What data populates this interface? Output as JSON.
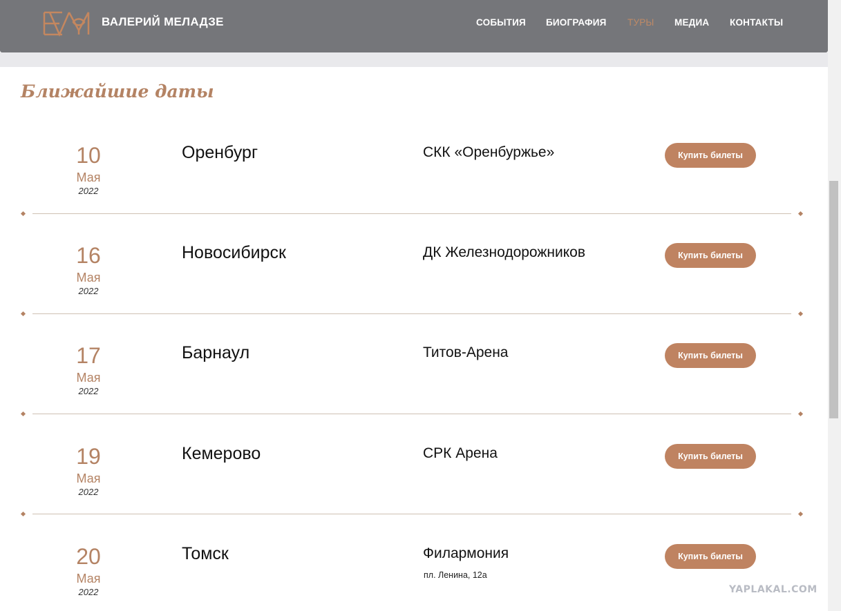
{
  "header": {
    "site_name": "ВАЛЕРИЙ МЕЛАДЗЕ",
    "logo_icon": "vm-monogram-logo",
    "nav": [
      {
        "label": "СОБЫТИЯ",
        "active": false
      },
      {
        "label": "БИОГРАФИЯ",
        "active": false
      },
      {
        "label": "ТУРЫ",
        "active": true
      },
      {
        "label": "МЕДИА",
        "active": false
      },
      {
        "label": "КОНТАКТЫ",
        "active": false
      }
    ]
  },
  "main": {
    "section_title": "Ближайшие даты",
    "events": [
      {
        "day": "10",
        "month": "Мая",
        "year": "2022",
        "city": "Оренбург",
        "venue": "СКК «Оренбуржье»",
        "address": "",
        "button": "Купить билеты"
      },
      {
        "day": "16",
        "month": "Мая",
        "year": "2022",
        "city": "Новосибирск",
        "venue": "ДК Железнодорожников",
        "address": "",
        "button": "Купить билеты"
      },
      {
        "day": "17",
        "month": "Мая",
        "year": "2022",
        "city": "Барнаул",
        "venue": "Титов-Арена",
        "address": "",
        "button": "Купить билеты"
      },
      {
        "day": "19",
        "month": "Мая",
        "year": "2022",
        "city": "Кемерово",
        "venue": "СРК Арена",
        "address": "",
        "button": "Купить билеты"
      },
      {
        "day": "20",
        "month": "Мая",
        "year": "2022",
        "city": "Томск",
        "venue": "Филармония",
        "address": "пл. Ленина, 12а",
        "button": "Купить билеты"
      }
    ]
  },
  "watermark": "YAPLAKAL.COM",
  "colors": {
    "accent": "#bf8361",
    "header_bg": "#75767a",
    "nav_active": "#bf8a66",
    "divider": "#cfc0b3"
  }
}
